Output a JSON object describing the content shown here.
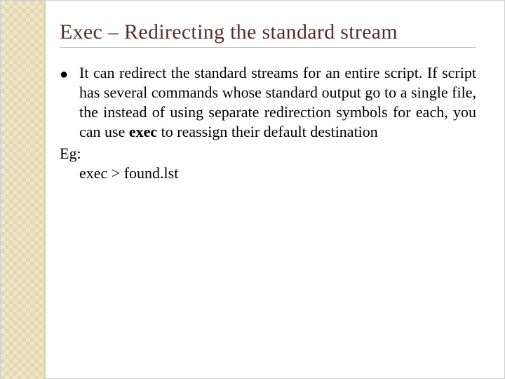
{
  "slide": {
    "title": "Exec – Redirecting the standard stream",
    "bullet_glyph": "●",
    "body_pre": "It can redirect the standard streams for an entire script. If script has several commands whose standard output go to a single file, the instead of using separate redirection symbols for each, you can use ",
    "body_bold": "exec",
    "body_post": " to reassign their default destination",
    "example_label": "Eg:",
    "example_command": "exec > found.lst"
  }
}
